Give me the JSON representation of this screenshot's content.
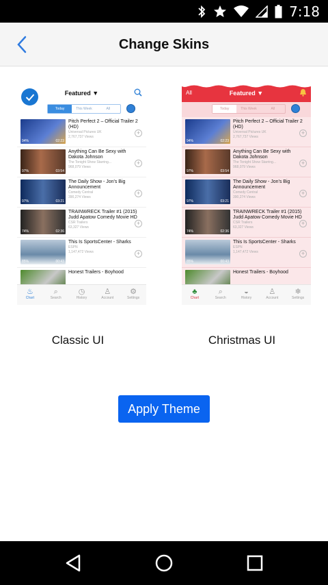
{
  "status_bar": {
    "time": "7:18"
  },
  "header": {
    "title": "Change Skins"
  },
  "skins": [
    {
      "name": "Classic UI",
      "selected": true,
      "preview": {
        "header_title": "Featured ▼",
        "segments": [
          "Today",
          "This Week",
          "All"
        ],
        "videos": [
          {
            "title": "Pitch Perfect 2 – Official Trailer 2 (HD)",
            "channel": "Universal Pictures UK",
            "views": "2,767,737 Views",
            "duration": "02:23",
            "percent": "94%"
          },
          {
            "title": "Anything Can Be Sexy with Dakota Johnson",
            "channel": "The Tonight Show Starring...",
            "views": "968,079 Views",
            "duration": "03:54",
            "percent": "97%"
          },
          {
            "title": "The Daily Show - Jon's Big Announcement",
            "channel": "Comedy Central",
            "views": "390,274 Views",
            "duration": "03:21",
            "percent": "97%"
          },
          {
            "title": "TRAINWRECK Trailer #1 (2015) Judd Apatow Comedy Movie HD",
            "channel": "CSR Trailers",
            "views": "63,327 Views",
            "duration": "02:36",
            "percent": "74%"
          },
          {
            "title": "This Is SportsCenter - Sharks",
            "channel": "ESPN",
            "views": "1,147,472 Views",
            "duration": "00:43",
            "percent": "85%"
          },
          {
            "title": "Honest Trailers - Boyhood",
            "channel": "",
            "views": "",
            "duration": "",
            "percent": ""
          }
        ],
        "tabs": [
          "Chart",
          "Search",
          "History",
          "Account",
          "Settings"
        ]
      }
    },
    {
      "name": "Christmas UI",
      "selected": false,
      "preview": {
        "header_left": "All",
        "header_title": "Featured ▼",
        "segments": [
          "Today",
          "This Week",
          "All"
        ],
        "videos": [
          {
            "title": "Pitch Perfect 2 – Official Trailer 2 (HD)",
            "channel": "Universal Pictures UK",
            "views": "2,767,737 Views",
            "duration": "02:23",
            "percent": "94%"
          },
          {
            "title": "Anything Can Be Sexy with Dakota Johnson",
            "channel": "The Tonight Show Starring...",
            "views": "968,079 Views",
            "duration": "03:54",
            "percent": "97%"
          },
          {
            "title": "The Daily Show - Jon's Big Announcement",
            "channel": "Comedy Central",
            "views": "390,274 Views",
            "duration": "03:21",
            "percent": "97%"
          },
          {
            "title": "TRAINWRECK Trailer #1 (2015) Judd Apatow Comedy Movie HD",
            "channel": "CSR Trailers",
            "views": "63,327 Views",
            "duration": "02:36",
            "percent": "74%"
          },
          {
            "title": "This Is SportsCenter - Sharks",
            "channel": "ESPN",
            "views": "1,147,472 Views",
            "duration": "00:43",
            "percent": "85%"
          },
          {
            "title": "Honest Trailers - Boyhood",
            "channel": "",
            "views": "",
            "duration": "",
            "percent": ""
          }
        ],
        "tabs": [
          "Chart",
          "Search",
          "History",
          "Account",
          "Settings"
        ]
      }
    }
  ],
  "apply_button": {
    "label": "Apply Theme"
  },
  "colors": {
    "accent": "#0a64f0",
    "header_bg": "#f5f5f5",
    "xmas_red": "#e7343f"
  }
}
